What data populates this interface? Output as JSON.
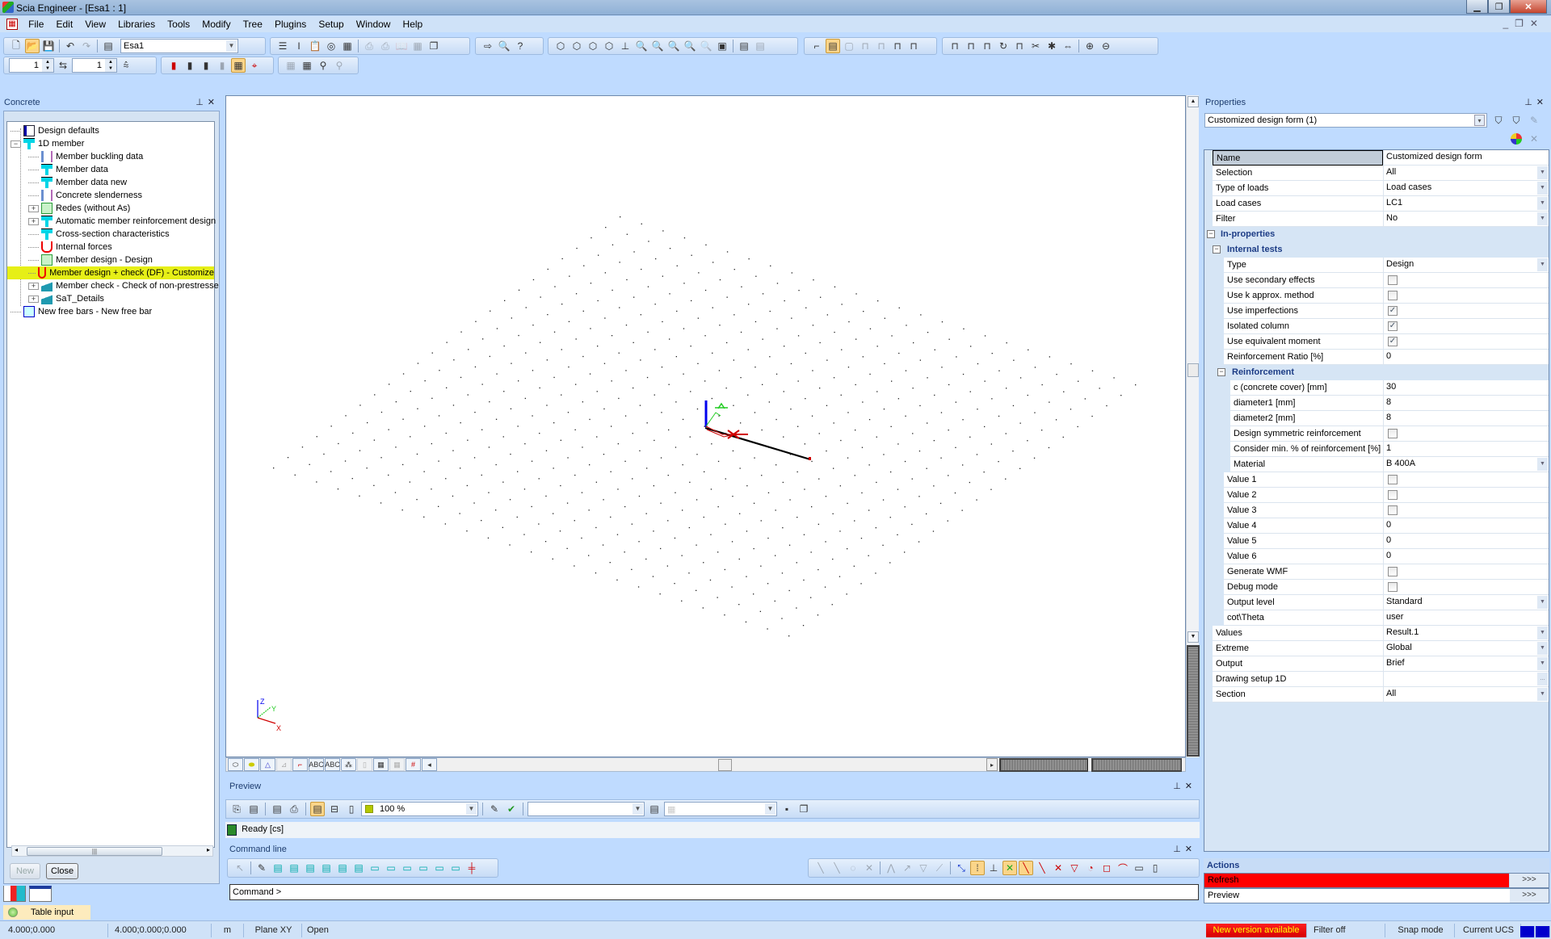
{
  "window": {
    "title": "Scia Engineer - [Esa1 : 1]",
    "controls": [
      "minimize",
      "restore",
      "close"
    ]
  },
  "menu": {
    "items": [
      "File",
      "Edit",
      "View",
      "Libraries",
      "Tools",
      "Modify",
      "Tree",
      "Plugins",
      "Setup",
      "Window",
      "Help"
    ]
  },
  "toolbar": {
    "project_combo": "Esa1",
    "spin1": "1",
    "spin2": "1"
  },
  "left_panel": {
    "title": "Concrete",
    "tree": [
      {
        "label": "Design defaults",
        "level": 0,
        "expander": "",
        "icon": "doc"
      },
      {
        "label": "1D member",
        "level": 0,
        "expander": "−",
        "icon": "t"
      },
      {
        "label": "Member buckling data",
        "level": 1,
        "expander": "",
        "icon": "buck"
      },
      {
        "label": "Member data",
        "level": 1,
        "expander": "",
        "icon": "t"
      },
      {
        "label": "Member data new",
        "level": 1,
        "expander": "",
        "icon": "t"
      },
      {
        "label": "Concrete slenderness",
        "level": 1,
        "expander": "",
        "icon": "buck"
      },
      {
        "label": "Redes (without As)",
        "level": 1,
        "expander": "+",
        "icon": "green"
      },
      {
        "label": "Automatic member reinforcement design",
        "level": 1,
        "expander": "+",
        "icon": "t"
      },
      {
        "label": "Cross-section characteristics",
        "level": 1,
        "expander": "",
        "icon": "t"
      },
      {
        "label": "Internal forces",
        "level": 1,
        "expander": "",
        "icon": "red"
      },
      {
        "label": "Member design - Design",
        "level": 1,
        "expander": "",
        "icon": "green"
      },
      {
        "label": "Member design + check (DF) - Customize",
        "level": 1,
        "expander": "",
        "icon": "red",
        "selected": true
      },
      {
        "label": "Member check - Check of non-prestresse",
        "level": 1,
        "expander": "+",
        "icon": "wave"
      },
      {
        "label": "SaT_Details",
        "level": 1,
        "expander": "+",
        "icon": "wave"
      },
      {
        "label": "New free bars - New free bar",
        "level": 0,
        "expander": "",
        "icon": "free"
      }
    ],
    "buttons": {
      "new": "New",
      "close": "Close"
    },
    "table_input": "Table input"
  },
  "viewport": {
    "axis_labels": {
      "x": "X",
      "y": "Y",
      "z": "Z"
    },
    "axis_colors": {
      "x": "#d00000",
      "y": "#22cc22",
      "z": "#0000ee"
    }
  },
  "preview": {
    "title": "Preview",
    "zoom": "100 %",
    "status": "Ready [cs]"
  },
  "command_line": {
    "title": "Command line",
    "prompt": "Command >"
  },
  "properties": {
    "title": "Properties",
    "selector": "Customized design form (1)",
    "rows": [
      {
        "label": "Name",
        "value": "Customized design form",
        "indent": 0,
        "kind": "text",
        "selected": true
      },
      {
        "label": "Selection",
        "value": "All",
        "indent": 0,
        "kind": "dropdown"
      },
      {
        "label": "Type of loads",
        "value": "Load cases",
        "indent": 0,
        "kind": "dropdown"
      },
      {
        "label": "Load cases",
        "value": "LC1",
        "indent": 0,
        "kind": "dropdown"
      },
      {
        "label": "Filter",
        "value": "No",
        "indent": 0,
        "kind": "dropdown"
      },
      {
        "label": "In-properties",
        "indent": 0,
        "kind": "group"
      },
      {
        "label": "Internal tests",
        "indent": 1,
        "kind": "group"
      },
      {
        "label": "Type",
        "value": "Design",
        "indent": 2,
        "kind": "dropdown"
      },
      {
        "label": "Use secondary effects",
        "checked": false,
        "indent": 2,
        "kind": "checkbox"
      },
      {
        "label": "Use k approx. method",
        "checked": false,
        "indent": 2,
        "kind": "checkbox"
      },
      {
        "label": "Use imperfections",
        "checked": true,
        "indent": 2,
        "kind": "checkbox"
      },
      {
        "label": "Isolated column",
        "checked": true,
        "indent": 2,
        "kind": "checkbox"
      },
      {
        "label": "Use equivalent moment",
        "checked": true,
        "indent": 2,
        "kind": "checkbox"
      },
      {
        "label": "Reinforcement Ratio [%]",
        "value": "0",
        "indent": 2,
        "kind": "text"
      },
      {
        "label": "Reinforcement",
        "indent": 2,
        "kind": "group"
      },
      {
        "label": "c (concrete cover) [mm]",
        "value": "30",
        "indent": 3,
        "kind": "text"
      },
      {
        "label": "diameter1 [mm]",
        "value": "8",
        "indent": 3,
        "kind": "text"
      },
      {
        "label": "diameter2 [mm]",
        "value": "8",
        "indent": 3,
        "kind": "text"
      },
      {
        "label": "Design symmetric reinforcement",
        "checked": false,
        "indent": 3,
        "kind": "checkbox"
      },
      {
        "label": "Consider min. % of reinforcement [%]",
        "value": "1",
        "indent": 3,
        "kind": "text"
      },
      {
        "label": "Material",
        "value": "B 400A",
        "indent": 3,
        "kind": "dropdown"
      },
      {
        "label": "Value 1",
        "checked": false,
        "indent": 1,
        "kind": "checkbox"
      },
      {
        "label": "Value 2",
        "checked": false,
        "indent": 1,
        "kind": "checkbox"
      },
      {
        "label": "Value 3",
        "checked": false,
        "indent": 1,
        "kind": "checkbox"
      },
      {
        "label": "Value 4",
        "value": "0",
        "indent": 1,
        "kind": "text"
      },
      {
        "label": "Value 5",
        "value": "0",
        "indent": 1,
        "kind": "text"
      },
      {
        "label": "Value 6",
        "value": "0",
        "indent": 1,
        "kind": "text"
      },
      {
        "label": "Generate WMF",
        "checked": false,
        "indent": 1,
        "kind": "checkbox"
      },
      {
        "label": "Debug mode",
        "checked": false,
        "indent": 1,
        "kind": "checkbox"
      },
      {
        "label": "Output level",
        "value": "Standard",
        "indent": 1,
        "kind": "dropdown"
      },
      {
        "label": "cot\\Theta",
        "value": "user",
        "indent": 1,
        "kind": "text"
      },
      {
        "label": "Values",
        "value": "Result.1",
        "indent": 0,
        "kind": "dropdown"
      },
      {
        "label": "Extreme",
        "value": "Global",
        "indent": 0,
        "kind": "dropdown"
      },
      {
        "label": "Output",
        "value": "Brief",
        "indent": 0,
        "kind": "dropdown"
      },
      {
        "label": "Drawing setup 1D",
        "value": "",
        "indent": 0,
        "kind": "ellipsis"
      },
      {
        "label": "Section",
        "value": "All",
        "indent": 0,
        "kind": "dropdown"
      }
    ],
    "actions_title": "Actions",
    "actions": [
      {
        "label": "Refresh",
        "button": ">>>",
        "highlight": "#ff0000"
      },
      {
        "label": "Preview",
        "button": ">>>",
        "highlight": ""
      }
    ]
  },
  "statusbar": {
    "cells": [
      "4.000;0.000",
      "4.000;0.000;0.000",
      "m",
      "Plane XY",
      "Open"
    ],
    "new_version": "New version available",
    "filter": "Filter off",
    "snap": "Snap mode",
    "ucs": "Current UCS"
  }
}
